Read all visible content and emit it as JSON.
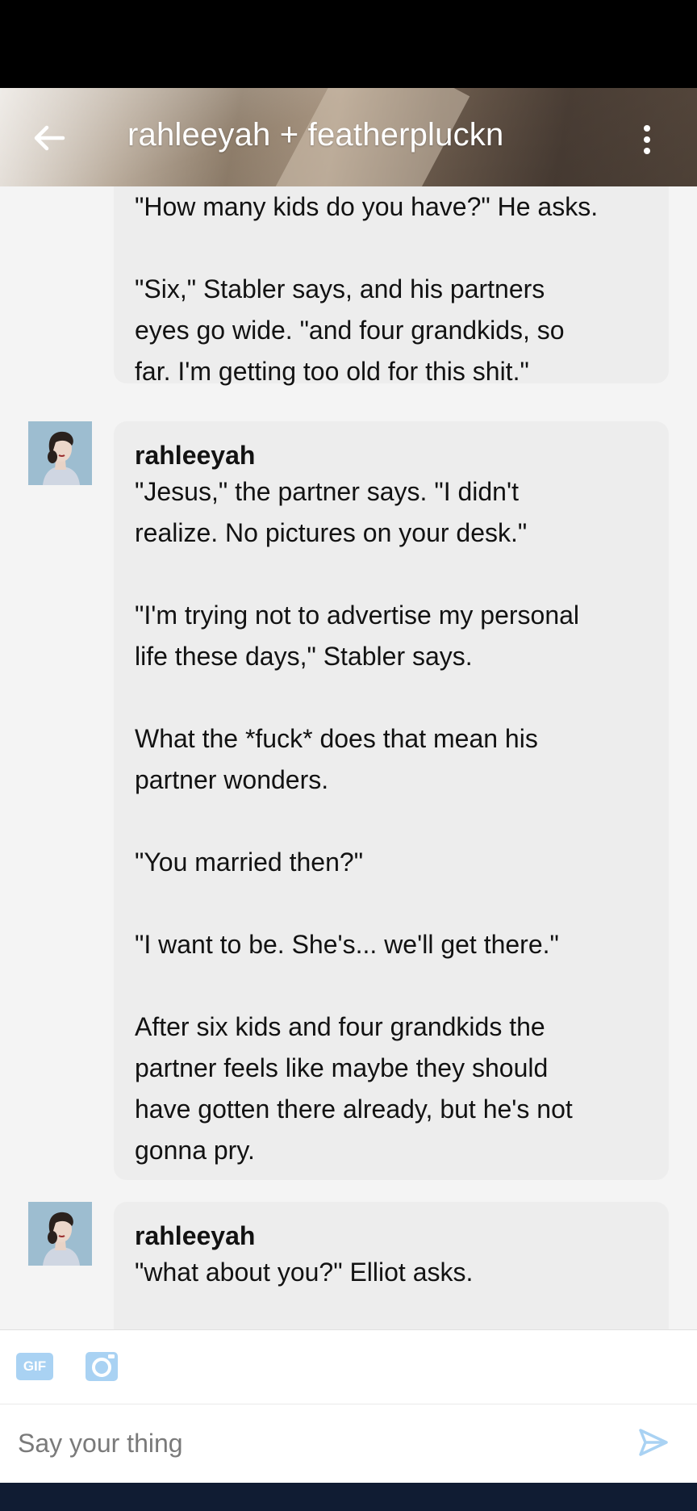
{
  "header": {
    "title": "rahleeyah + featherpluckn"
  },
  "messages": [
    {
      "paragraphs": [
        "\"How many kids do you have?\" He asks.",
        "\"Six,\" Stabler says, and his partners\neyes go wide. \"and four grandkids, so\nfar. I'm getting too old for this shit.\""
      ]
    },
    {
      "author": "rahleeyah",
      "paragraphs": [
        "\"Jesus,\" the partner says. \"I didn't\nrealize. No pictures on your desk.\"",
        "\"I'm trying not to advertise my personal\nlife these days,\" Stabler says.",
        "What the *fuck* does that mean his\npartner wonders.",
        "\"You married then?\"",
        "\"I want to be. She's... we'll get there.\"",
        "After six kids and four grandkids the\npartner feels like maybe they should\nhave gotten there already, but he's not\ngonna pry."
      ]
    },
    {
      "author": "rahleeyah",
      "paragraphs": [
        "\"what about you?\" Elliot asks."
      ]
    }
  ],
  "composer": {
    "gif_label": "GIF",
    "placeholder": "Say your thing"
  },
  "icons": {
    "back": "arrow-left-icon",
    "menu": "more-vertical-icon",
    "camera": "camera-icon",
    "send": "send-icon"
  },
  "colors": {
    "accent": "#a9d2f3",
    "bubble": "#ededed",
    "nav": "#101c33"
  }
}
